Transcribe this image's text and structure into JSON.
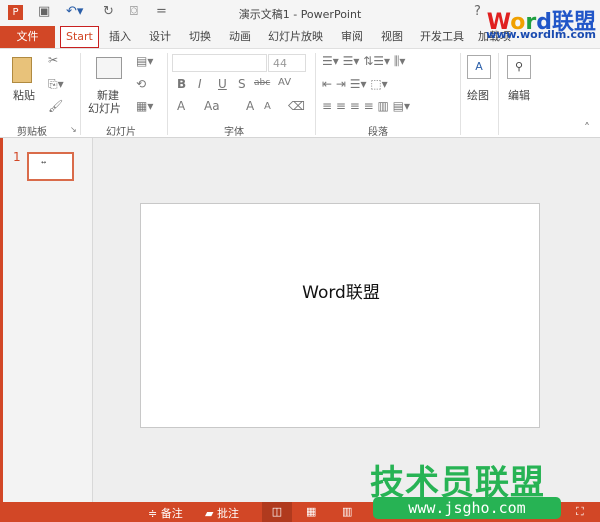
{
  "window": {
    "title": "演示文稿1 - PowerPoint",
    "help": "?"
  },
  "quick_access": {
    "app_icon": "P",
    "save": "save-icon",
    "undo": "undo-icon",
    "redo": "redo-icon",
    "present": "present-icon",
    "customize": "="
  },
  "tabs": [
    "文件",
    "Start",
    "插入",
    "设计",
    "切换",
    "动画",
    "幻灯片放映",
    "审阅",
    "视图",
    "开发工具",
    "加载项"
  ],
  "ribbon": {
    "clipboard": {
      "paste": "粘贴",
      "label": "剪贴板"
    },
    "slides": {
      "new_slide_line1": "新建",
      "new_slide_line2": "幻灯片",
      "label": "幻灯片"
    },
    "font": {
      "font_name": "",
      "font_size": "44",
      "bold": "B",
      "italic": "I",
      "underline": "U",
      "shadow": "S",
      "strike": "abc",
      "spacing": "AV",
      "color": "A",
      "case": "Aa",
      "grow": "A",
      "shrink": "A",
      "label": "字体"
    },
    "paragraph": {
      "label": "段落"
    },
    "drawing": {
      "label": "绘图"
    },
    "editing": {
      "label": "编辑"
    }
  },
  "slides_pane": {
    "slide_number": "1"
  },
  "slide": {
    "text": "Word联盟"
  },
  "status": {
    "notes": "备注",
    "comments": "批注"
  },
  "watermarks": {
    "top_logo": "Word联盟",
    "top_url": "www.wordlm.com",
    "bottom_logo": "技术员联盟",
    "bottom_url": "www.jsgho.com"
  },
  "colors": {
    "accent": "#d24726",
    "start_outline": "#c82020",
    "watermark_green": "#27b354"
  }
}
